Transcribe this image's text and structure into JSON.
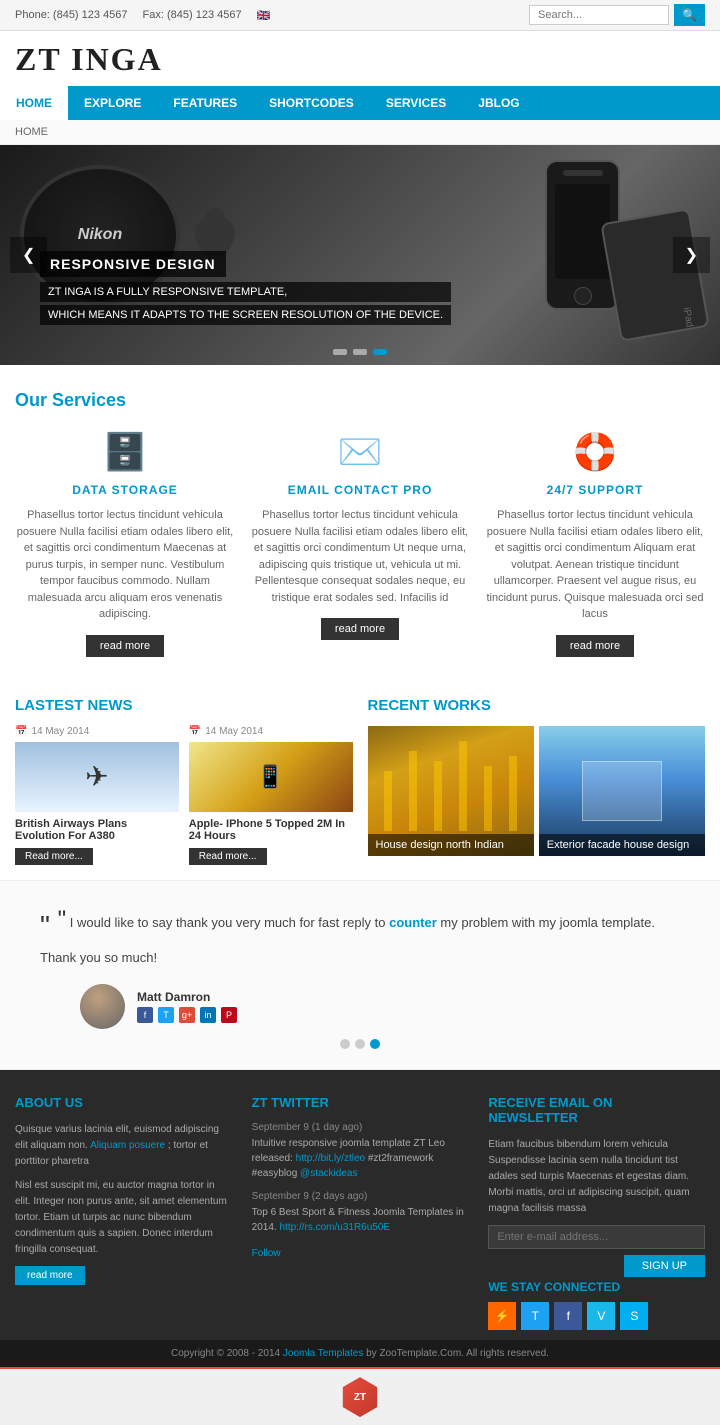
{
  "topbar": {
    "phone": "Phone: (845) 123 4567",
    "fax": "Fax: (845) 123 4567",
    "search_placeholder": "Search..."
  },
  "logo": {
    "text": "ZT INGA"
  },
  "nav": {
    "items": [
      {
        "label": "HOME",
        "active": true
      },
      {
        "label": "EXPLORE",
        "active": false
      },
      {
        "label": "FEATURES",
        "active": false
      },
      {
        "label": "SHORTCODES",
        "active": false
      },
      {
        "label": "SERVICES",
        "active": false
      },
      {
        "label": "JBLOG",
        "active": false
      }
    ]
  },
  "breadcrumb": "HOME",
  "slider": {
    "title": "RESPONSIVE DESIGN",
    "subtitle1": "ZT INGA IS A FULLY RESPONSIVE TEMPLATE,",
    "subtitle2": "WHICH MEANS IT ADAPTS TO THE SCREEN RESOLUTION OF THE DEVICE.",
    "dots": [
      "",
      "",
      "active"
    ]
  },
  "services": {
    "title": "Our Services",
    "items": [
      {
        "icon": "🗄️",
        "title": "DATA STORAGE",
        "desc": "Phasellus tortor lectus tincidunt vehicula posuere Nulla facilisi etiam odales libero elit, et sagittis orci condimentum Maecenas at purus turpis, in semper nunc. Vestibulum tempor faucibus commodo. Nullam malesuada arcu aliquam eros venenatis adipiscing.",
        "button": "read more"
      },
      {
        "icon": "✉️",
        "title": "EMAIL CONTACT PRO",
        "desc": "Phasellus tortor lectus tincidunt vehicula posuere Nulla facilisi etiam odales libero elit, et sagittis orci condimentum Ut neque urna, adipiscing quis tristique ut, vehicula ut mi. Pellentesque consequat sodales neque, eu tristique erat sodales sed. Infacilis id",
        "button": "read more"
      },
      {
        "icon": "🛟",
        "title": "24/7 SUPPORT",
        "desc": "Phasellus tortor lectus tincidunt vehicula posuere Nulla facilisi etiam odales libero elit, et sagittis orci condimentum Aliquam erat volutpat. Aenean tristique tincidunt ullamcorper. Praesent vel augue risus, eu tincidunt purus. Quisque malesuada orci sed lacus",
        "button": "read more"
      }
    ]
  },
  "news": {
    "title": "LASTEST ",
    "title_colored": "NEWS",
    "items": [
      {
        "date": "14 May 2014",
        "title": "British Airways Plans Evolution For A380",
        "button": "Read more..."
      },
      {
        "date": "14 May 2014",
        "title": "Apple- IPhone 5 Topped 2M In 24 Hours",
        "button": "Read more..."
      }
    ]
  },
  "recent_works": {
    "title": "RECENT ",
    "title_colored": "WORKS",
    "items": [
      {
        "label": "House design north Indian"
      },
      {
        "label": "Exterior facade house design"
      }
    ]
  },
  "testimonial": {
    "quote": "I would like to say thank you very much for fast reply to counter my problem with my joomla template. Thank you so much!",
    "counter_word": "counter",
    "author": "Matt Damron"
  },
  "footer": {
    "about": {
      "title": "ABOUT ",
      "title_colored": "US",
      "para1": "Quisque varius lacinia elit, euismod adipiscing elit aliquam non. Aliquam posuere; tortor et porttitor pharetra",
      "para2": "Nisl est suscipit mi, eu auctor magna tortor in elit. Integer non purus ante, sit amet elementum tortor. Etiam ut turpis ac nunc bibendum condimentum quis a sapien. Donec interdum fringilla consequat.",
      "button": "read more"
    },
    "twitter": {
      "title": "ZT ",
      "title_colored": "TWITTER",
      "tweets": [
        {
          "date": "September 9 (1 day ago)",
          "text": "Intuitive responsive joomla template ZT Leo released:http://bit.ly/ztleo #zt2framework #easyblog @stackideas"
        },
        {
          "date": "September 9 (2 days ago)",
          "text": "Top 6 Best Sport & Fitness Joomla Templates in 2014. http://rs.com/u31R6u50E",
          "link": "Follow"
        }
      ]
    },
    "newsletter": {
      "title": "RECEIVE ",
      "title_colored": "EMAIL ON NEWSLETTER",
      "desc": "Etiam faucibus bibendum lorem vehicula Suspendisse lacinia sem nulla tincidunt tist adales sed turpis Maecenas et egestas diam. Morbi mattis, orci ut adipiscing suscipit, quam magna facilisis massa",
      "placeholder": "Enter e-mail address...",
      "button": "SIGN UP",
      "stay_connected": "WE STAY ",
      "stay_connected_colored": "CONNECTED",
      "social_icons": [
        "RSS",
        "T",
        "f",
        "V",
        "S"
      ]
    }
  },
  "copyright": {
    "text": "Copyright © 2008 - 2014 Joomla Templates by ZooTemplate.Com. All rights reserved."
  }
}
